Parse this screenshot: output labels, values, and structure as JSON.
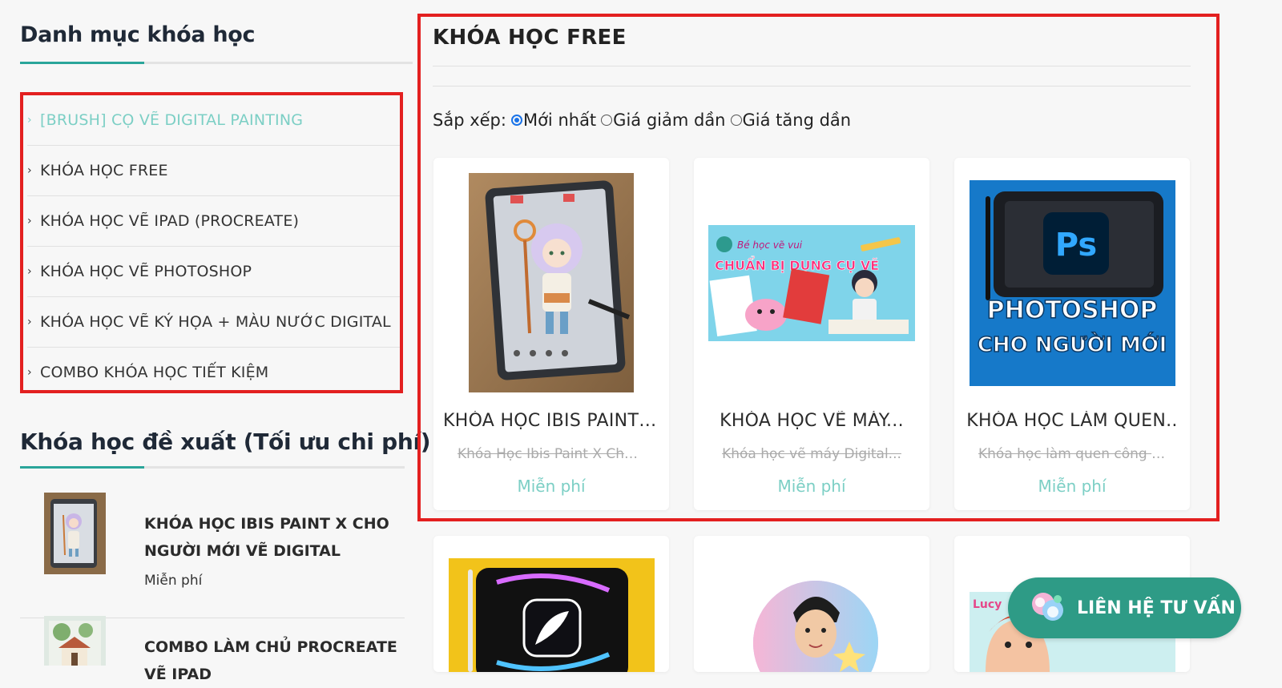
{
  "sidebar": {
    "title": "Danh mục khóa học",
    "categories": [
      {
        "label": "[BRUSH] CỌ VẼ DIGITAL PAINTING",
        "active": true
      },
      {
        "label": "KHÓA HỌC FREE",
        "active": false
      },
      {
        "label": "KHÓA HỌC VẼ IPAD (PROCREATE)",
        "active": false
      },
      {
        "label": "KHÓA HỌC VẼ PHOTOSHOP",
        "active": false
      },
      {
        "label": "KHÓA HỌC VẼ KÝ HỌA + MÀU NƯỚC DIGITAL",
        "active": false
      },
      {
        "label": "COMBO KHÓA HỌC TIẾT KIỆM",
        "active": false
      }
    ],
    "recommended_title": "Khóa học đề xuất (Tối ưu chi phí)",
    "recommended": [
      {
        "name": "KHÓA HỌC IBIS PAINT X CHO NGƯỜI MỚI VẼ DIGITAL",
        "price": "Miễn phí"
      },
      {
        "name": "COMBO LÀM CHỦ PROCREATE VẼ IPAD",
        "price": ""
      }
    ]
  },
  "main": {
    "title": "KHÓA HỌC FREE",
    "sort": {
      "label": "Sắp xếp:",
      "options": [
        "Mới nhất",
        "Giá giảm dần",
        "Giá tăng dần"
      ],
      "selected": "Mới nhất"
    },
    "cards": [
      {
        "title": "KHÓA HỌC IBIS PAINT ...",
        "subtitle": "Khóa Học Ibis Paint X Cho...",
        "price": "Miễn phí"
      },
      {
        "title": "KHÓA HỌC VẼ MÁY...",
        "subtitle": "Khóa học vẽ máy Digital...",
        "price": "Miễn phí"
      },
      {
        "title": "KHÓA HỌC LÀM QUEN..",
        "subtitle": "Khóa học làm quen công cụ..",
        "price": "Miễn phí"
      }
    ],
    "card_image_text": {
      "card2_line1": "Bé học vẽ vui",
      "card2_line2": "CHUẨN BỊ DỤNG CỤ VẼ",
      "card3_logo": "Ps",
      "card3_line1": "PHOTOSHOP",
      "card3_line2": "CHO NGƯỜI MỚI",
      "row2_card3_badge": "Lucy"
    }
  },
  "contact": {
    "label": "LIÊN HỆ TƯ VẤN"
  },
  "colors": {
    "accent": "#7ccfc5",
    "brand_green": "#2e9b86",
    "highlight_red": "#e32020",
    "rule_teal": "#2aa59a"
  }
}
